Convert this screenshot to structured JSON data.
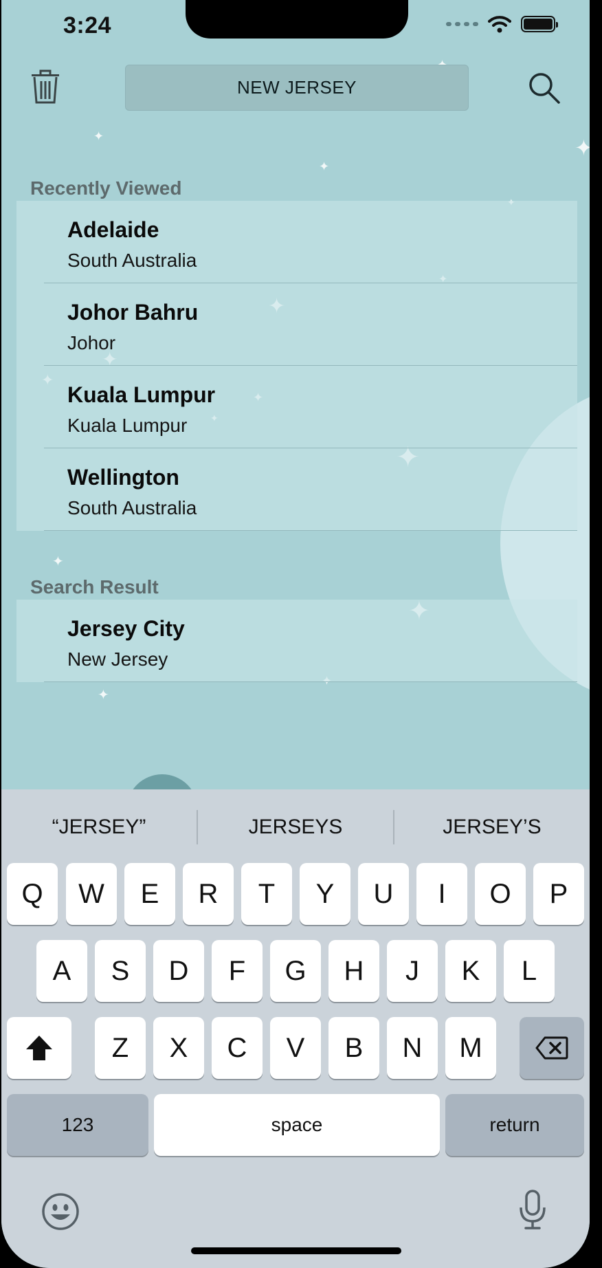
{
  "status_bar": {
    "time": "3:24"
  },
  "header": {
    "search_value": "NEW JERSEY"
  },
  "recently_viewed": {
    "title": "Recently Viewed",
    "items": [
      {
        "city": "Adelaide",
        "region": "South Australia"
      },
      {
        "city": "Johor Bahru",
        "region": "Johor"
      },
      {
        "city": "Kuala Lumpur",
        "region": "Kuala Lumpur"
      },
      {
        "city": "Wellington",
        "region": "South Australia"
      }
    ]
  },
  "search_result": {
    "title": "Search Result",
    "items": [
      {
        "city": "Jersey City",
        "region": "New Jersey"
      }
    ]
  },
  "keyboard": {
    "suggestions": [
      "“JERSEY”",
      "JERSEYS",
      "JERSEY’S"
    ],
    "row1": [
      "Q",
      "W",
      "E",
      "R",
      "T",
      "Y",
      "U",
      "I",
      "O",
      "P"
    ],
    "row2": [
      "A",
      "S",
      "D",
      "F",
      "G",
      "H",
      "J",
      "K",
      "L"
    ],
    "row3": [
      "Z",
      "X",
      "C",
      "V",
      "B",
      "N",
      "M"
    ],
    "numbers_label": "123",
    "space_label": "space",
    "return_label": "return"
  },
  "icons": {
    "trash": "trash-icon",
    "search": "search-icon",
    "shift": "shift-icon",
    "delete": "delete-icon",
    "emoji": "emoji-icon",
    "mic": "mic-icon"
  },
  "colors": {
    "background": "#a8d1d5",
    "list_background": "#c0dfe2",
    "keyboard": "#cbd3da"
  }
}
